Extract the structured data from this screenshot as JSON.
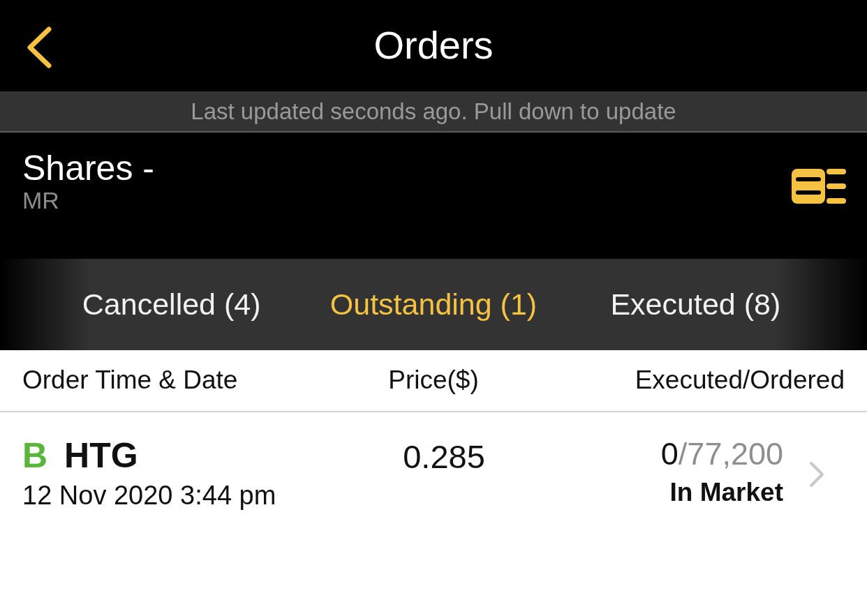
{
  "nav": {
    "title": "Orders"
  },
  "update_notice": "Last updated seconds ago. Pull down to update",
  "account": {
    "title": "Shares -",
    "holder": "MR"
  },
  "tabs": [
    {
      "label": "Cancelled (4)",
      "selected": false
    },
    {
      "label": "Outstanding (1)",
      "selected": true
    },
    {
      "label": "Executed (8)",
      "selected": false
    }
  ],
  "table": {
    "columns": [
      "Order Time & Date",
      "Price($)",
      "Executed/Ordered"
    ],
    "rows": [
      {
        "side": "B",
        "color": "#5ab53b",
        "symbol": "HTG",
        "datetime": "12 Nov 2020 3:44 pm",
        "price": "0.285",
        "executed": "0",
        "ordered": "/77,200",
        "status": "In Market"
      }
    ]
  }
}
